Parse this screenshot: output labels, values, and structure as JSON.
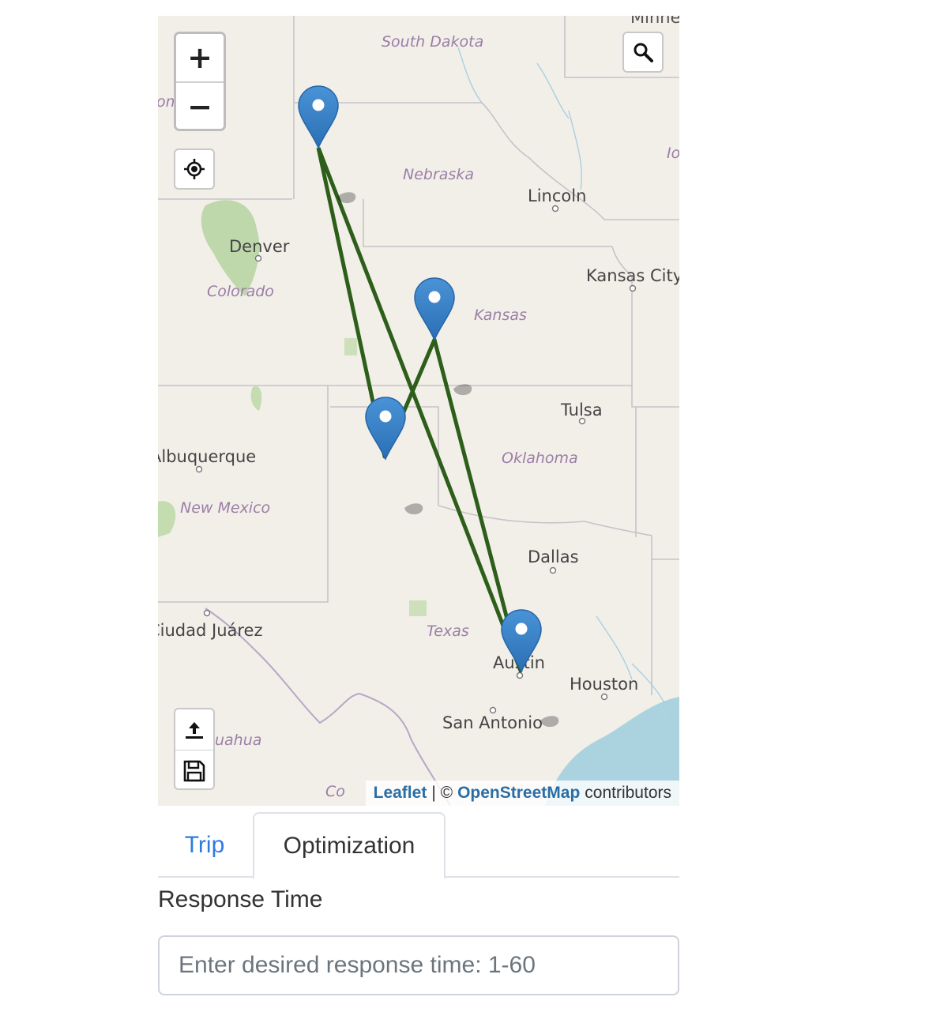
{
  "map": {
    "states": [
      "South Dakota",
      "Nebraska",
      "Colorado",
      "Kansas",
      "Oklahoma",
      "New Mexico",
      "Texas"
    ],
    "cities": [
      "Lincoln",
      "Denver",
      "Kansas City",
      "Tulsa",
      "Albuquerque",
      "Dallas",
      "Ciudad Juárez",
      "Austin",
      "Houston",
      "San Antonio"
    ],
    "edge_fragments": [
      "Minne",
      "Io",
      "om",
      "uahua",
      "Co"
    ],
    "zoom_in": "+",
    "zoom_out": "−",
    "route_color": "#2d5e1a",
    "marker_color": "#2f7dc8",
    "marker_count": 4,
    "attribution": {
      "leaflet": "Leaflet",
      "separator": "| ©",
      "osm": "OpenStreetMap",
      "suffix": "contributors"
    }
  },
  "tabs": [
    {
      "label": "Trip",
      "active": false
    },
    {
      "label": "Optimization",
      "active": true
    }
  ],
  "form": {
    "response_time_label": "Response Time",
    "response_time_placeholder": "Enter desired response time: 1-60",
    "response_time_value": ""
  }
}
